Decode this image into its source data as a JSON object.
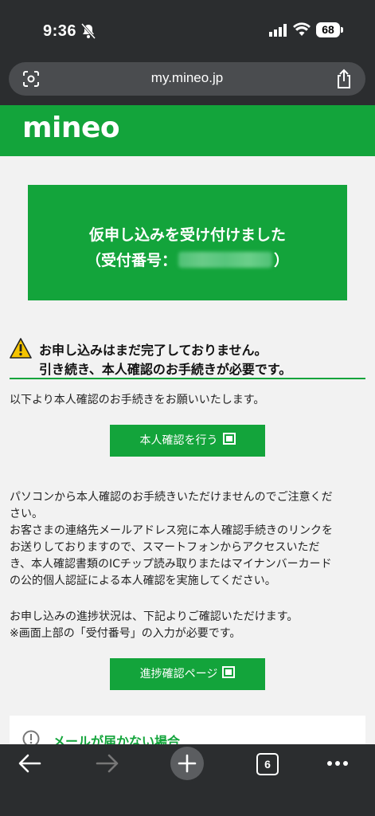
{
  "status": {
    "time": "9:36",
    "battery": "68"
  },
  "browser": {
    "url": "my.mineo.jp",
    "tab_count": "6"
  },
  "brand": {
    "logo": "mineo"
  },
  "banner": {
    "line1": "仮申し込みを受け付けました",
    "line2_prefix": "（受付番号：",
    "line2_suffix": "）"
  },
  "warning": {
    "line1": "お申し込みはまだ完了しておりません。",
    "line2": "引き続き、本人確認のお手続きが必要です。"
  },
  "intro": "以下より本人確認のお手続きをお願いいたします。",
  "verify_button": "本人確認を行う",
  "notice": [
    "パソコンから本人確認のお手続きいただけませんのでご注意くだ",
    "さい。",
    "お客さまの連絡先メールアドレス宛に本人確認手続きのリンクを",
    "お送りしておりますので、スマートフォンからアクセスいただ",
    "き、本人確認書類のICチップ読み取りまたはマイナンバーカード",
    "の公的個人認証による本人確認を実施してください。"
  ],
  "progress_text": [
    "お申し込みの進捗状況は、下記よりご確認いただけます。",
    "※画面上部の「受付番号」の入力が必要です。"
  ],
  "progress_button": "進捗確認ページ",
  "mail_card": {
    "label": "メールが届かない場合"
  },
  "colors": {
    "brand_green": "#13a43b",
    "chrome_dark": "#2b2d2f"
  },
  "icons": [
    "bell-slash-icon",
    "signal-icon",
    "wifi-icon",
    "lens-icon",
    "share-icon",
    "warning-icon",
    "external-window-icon",
    "info-circle-icon",
    "back-arrow-icon",
    "forward-arrow-icon",
    "plus-icon",
    "tabs-icon",
    "more-icon"
  ]
}
